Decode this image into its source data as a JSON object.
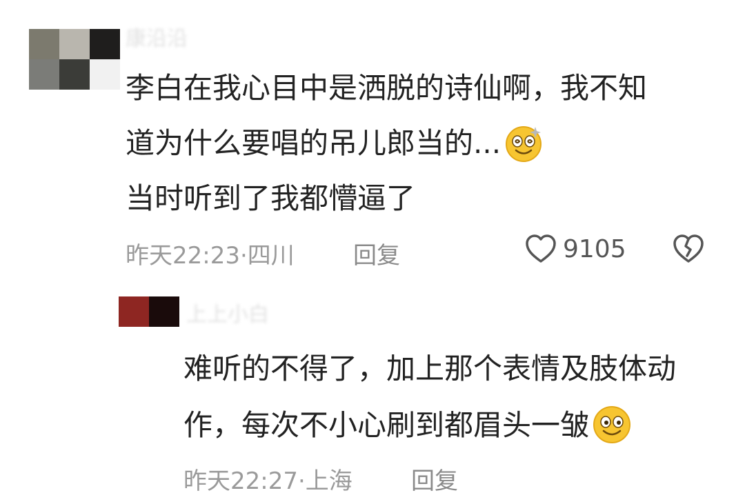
{
  "comments": [
    {
      "username": "康沿沿",
      "lines": [
        "李白在我心目中是洒脱的诗仙啊，我不知",
        "道为什么要唱的吊儿郎当的...",
        "当时听到了我都懵逼了"
      ],
      "time": "昨天22:23",
      "separator": " · ",
      "location": "四川",
      "reply_label": "回复",
      "like_count": "9105",
      "emoji_icon": "dizzy-smile-emoji"
    },
    {
      "username": "上上小白",
      "lines": [
        "难听的不得了，加上那个表情及肢体动",
        "作，每次不小心刷到都眉头一皱"
      ],
      "time": "昨天22:27",
      "separator": " · ",
      "location": "上海",
      "reply_label": "回复",
      "emoji_icon": "smile-emoji"
    }
  ],
  "icons": [
    "heart-outline-icon",
    "broken-heart-icon"
  ],
  "colors": {
    "text": "#222222",
    "meta": "#9a9a9a",
    "emoji": "#f7c531",
    "avatar1": [
      "#7c7a6e",
      "#b9b6ae",
      "#1f1e1d",
      "#7b7c78",
      "#3b3c38"
    ],
    "avatar2": [
      "#8e2622",
      "#1a0b0b"
    ]
  }
}
